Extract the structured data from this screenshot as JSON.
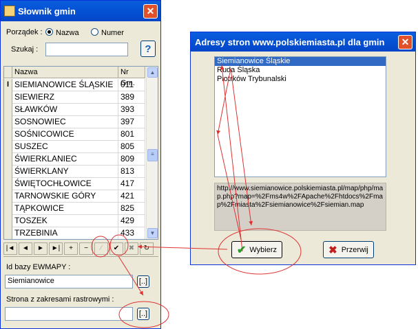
{
  "left_window": {
    "title": "Słownik gmin",
    "order_label": "Porządek :",
    "radio_name": "Nazwa",
    "radio_number": "Numer",
    "search_label": "Szukaj :",
    "search_value": "",
    "help_label": "?",
    "columns": [
      "Nazwa",
      "Nr Gm."
    ],
    "rows": [
      {
        "name": "SIEMIANOWICE ŚLĄSKIE",
        "nr": "011"
      },
      {
        "name": "SIEWIERZ",
        "nr": "389"
      },
      {
        "name": "SŁAWKÓW",
        "nr": "393"
      },
      {
        "name": "SOSNOWIEC",
        "nr": "397"
      },
      {
        "name": "SOŚNICOWICE",
        "nr": "801"
      },
      {
        "name": "SUSZEC",
        "nr": "805"
      },
      {
        "name": "ŚWIERKLANIEC",
        "nr": "809"
      },
      {
        "name": "ŚWIERKLANY",
        "nr": "813"
      },
      {
        "name": "ŚWIĘTOCHŁOWICE",
        "nr": "417"
      },
      {
        "name": "TARNOWSKIE GÓRY",
        "nr": "421"
      },
      {
        "name": "TĄPKOWICE",
        "nr": "825"
      },
      {
        "name": "TOSZEK",
        "nr": "429"
      },
      {
        "name": "TRZEBINIA",
        "nr": "433"
      }
    ],
    "row_indicator": "I",
    "nav_buttons": [
      "|◄",
      "◄",
      "►",
      "►|",
      "+",
      "−",
      "⁄",
      "✔",
      "✖",
      "↻"
    ],
    "base_label": "Id bazy EWMAPY :",
    "base_value": "Siemianowice",
    "browse_label": "[..]",
    "page_label": "Strona z zakresami rastrowymi :",
    "page_value": "",
    "browse2_label": "[..]"
  },
  "right_window": {
    "title": "Adresy stron www.polskiemiasta.pl dla gmin",
    "items": [
      "Siemianowice Śląskie",
      "Ruda Śląska",
      "Piotrków Trybunalski"
    ],
    "url": "http://www.siemianowice.polskiemiasta.pl/map/php/map.php?map=%2Fms4w%2FApache%2Fhtdocs%2Fmap%2Fmiasta%2Fsiemianowice%2Fsiemian.map",
    "select_label": "Wybierz",
    "cancel_label": "Przerwij"
  },
  "colors": {
    "titlebar": "#0553d6",
    "annotation": "#e03030",
    "selection": "#316ac5"
  }
}
